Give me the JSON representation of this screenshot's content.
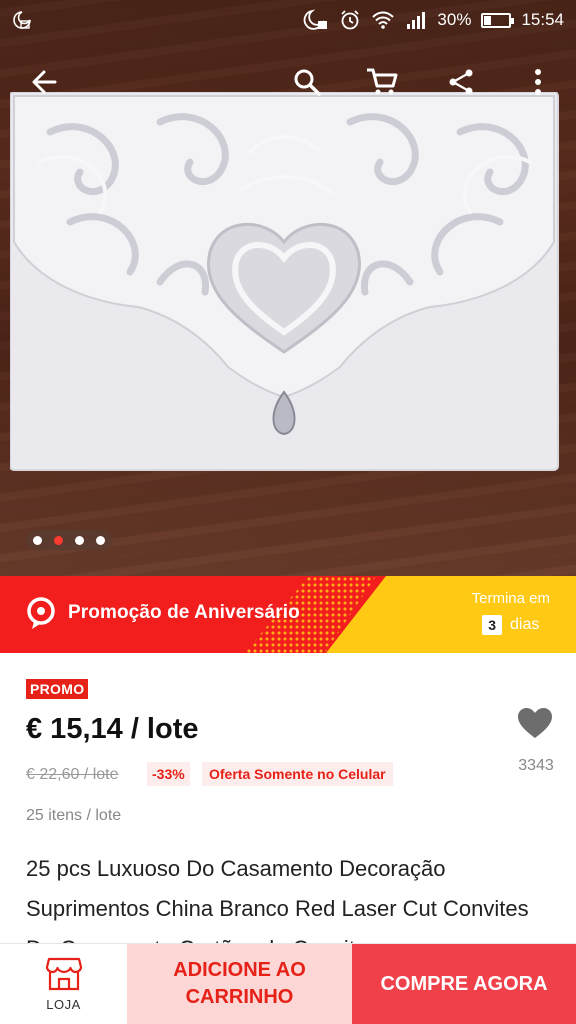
{
  "status_bar": {
    "battery_percent": "30%",
    "time": "15:54",
    "battery_level": 0.3
  },
  "toolbar": {
    "icons": [
      "back-arrow-icon",
      "search-icon",
      "cart-icon",
      "share-icon",
      "more-vert-icon"
    ]
  },
  "gallery": {
    "image_count": 4,
    "active_index": 1
  },
  "promo_banner": {
    "title": "Promoção de Aniversário",
    "ends_label": "Termina em",
    "days_value": "3",
    "days_label": "dias"
  },
  "product": {
    "badge": "PROMO",
    "price": "€ 15,14 / lote",
    "old_price": "€ 22,60 / lote",
    "discount": "-33%",
    "mobile_offer": "Oferta Somente no Celular",
    "lot_info": "25 itens / lote",
    "wishlist_count": "3343",
    "title": "25 pcs Luxuoso Do Casamento Decoração Suprimentos China Branco Red Laser Cut Convites De Casamento Cartões de Convite"
  },
  "actions": {
    "store_label": "LOJA",
    "add_to_cart_line1": "ADICIONE AO",
    "add_to_cart_line2": "CARRINHO",
    "buy_now": "COMPRE AGORA"
  },
  "colors": {
    "accent_red": "#e62117",
    "promo_red": "#f21d1d",
    "promo_yellow": "#ffc914",
    "cart_bg": "#fdd7d5",
    "buy_bg": "#f0404a"
  }
}
